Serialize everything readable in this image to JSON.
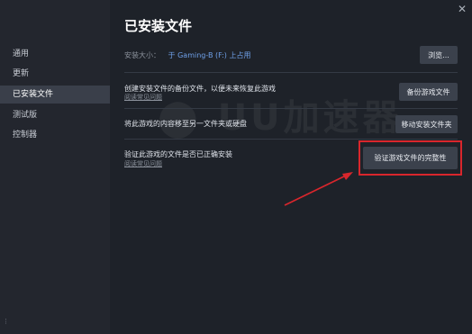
{
  "window": {
    "close_glyph": "✕"
  },
  "sidebar": {
    "items": [
      {
        "label": "通用",
        "active": false
      },
      {
        "label": "更新",
        "active": false
      },
      {
        "label": "已安装文件",
        "active": true
      },
      {
        "label": "测试版",
        "active": false
      },
      {
        "label": "控制器",
        "active": false
      }
    ],
    "bottom_glyph": "⋮"
  },
  "main": {
    "title": "已安装文件",
    "size_label": "安装大小：",
    "drive": "于 Gaming-B (F:) 上占用",
    "browse_label": "浏览...",
    "sections": [
      {
        "description": "创建安装文件的备份文件，以便未来恢复此游戏",
        "faq": "阅读常见问题",
        "button": "备份游戏文件"
      },
      {
        "description": "将此游戏的内容移至另一文件夹或硬盘",
        "faq": "",
        "button": "移动安装文件夹"
      },
      {
        "description": "验证此游戏的文件是否已正确安装",
        "faq": "阅读常见问题",
        "button": "验证游戏文件的完整性"
      }
    ]
  },
  "annotation": {
    "color": "#d9262c"
  }
}
